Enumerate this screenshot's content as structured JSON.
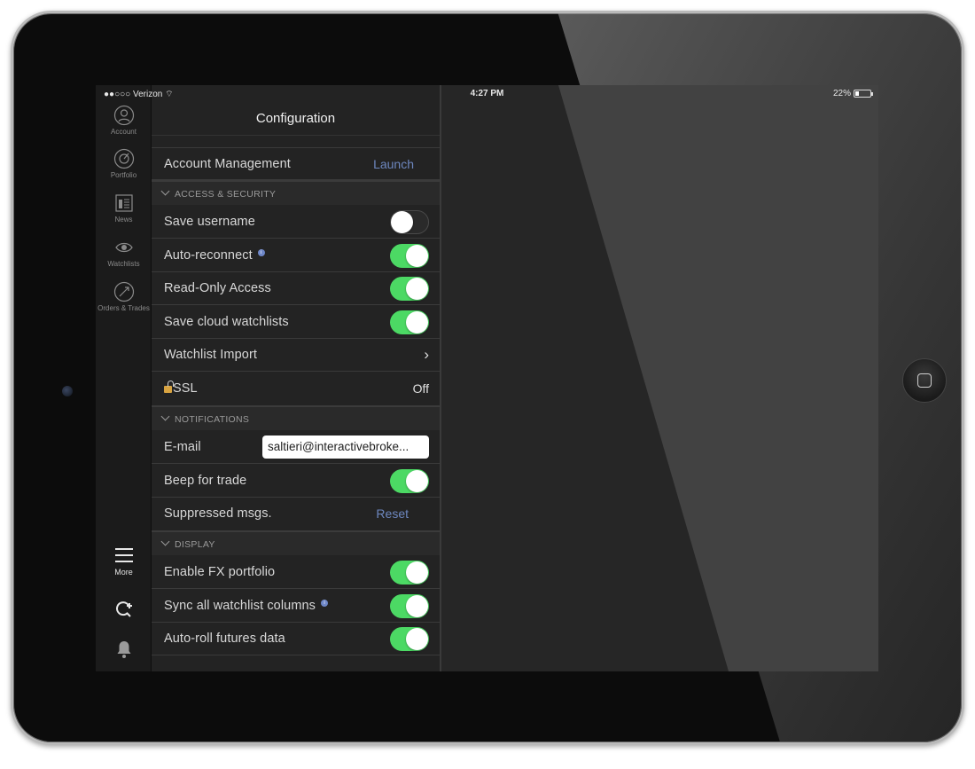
{
  "status_bar": {
    "carrier": "●●○○○ Verizon",
    "time": "4:27 PM",
    "battery": "22%",
    "battery_level": 0.22
  },
  "sidebar": {
    "items": [
      {
        "label": "Account",
        "icon": "account-icon"
      },
      {
        "label": "Portfolio",
        "icon": "portfolio-icon"
      },
      {
        "label": "News",
        "icon": "news-icon"
      },
      {
        "label": "Watchlists",
        "icon": "watchlists-icon"
      },
      {
        "label": "Orders & Trades",
        "icon": "orders-trades-icon"
      }
    ],
    "more_label": "More",
    "bottom_icons": [
      "quote-search-icon",
      "bell-icon"
    ]
  },
  "panel": {
    "title": "Configuration",
    "account_management": {
      "label": "Account Management",
      "action": "Launch"
    },
    "sections": {
      "access": "ACCESS & SECURITY",
      "notifications": "NOTIFICATIONS",
      "display": "DISPLAY"
    },
    "rows": {
      "save_username": {
        "label": "Save username",
        "on": false
      },
      "auto_reconnect": {
        "label": "Auto-reconnect",
        "on": true
      },
      "read_only": {
        "label": "Read-Only Access",
        "on": true
      },
      "save_cloud": {
        "label": "Save cloud watchlists",
        "on": true
      },
      "watchlist_import": {
        "label": "Watchlist Import"
      },
      "ssl": {
        "label": "SSL",
        "value": "Off"
      },
      "email": {
        "label": "E-mail",
        "value": "saltieri@interactivebroke..."
      },
      "beep": {
        "label": "Beep for trade",
        "on": true
      },
      "suppressed": {
        "label": "Suppressed msgs.",
        "action": "Reset"
      },
      "fx": {
        "label": "Enable FX portfolio",
        "on": true
      },
      "sync": {
        "label": "Sync all watchlist columns",
        "on": true
      },
      "autoroll": {
        "label": "Auto-roll futures data",
        "on": true
      }
    }
  },
  "colors": {
    "toggle_on": "#4cd964",
    "link": "#6d87bf",
    "background": "#262626"
  }
}
